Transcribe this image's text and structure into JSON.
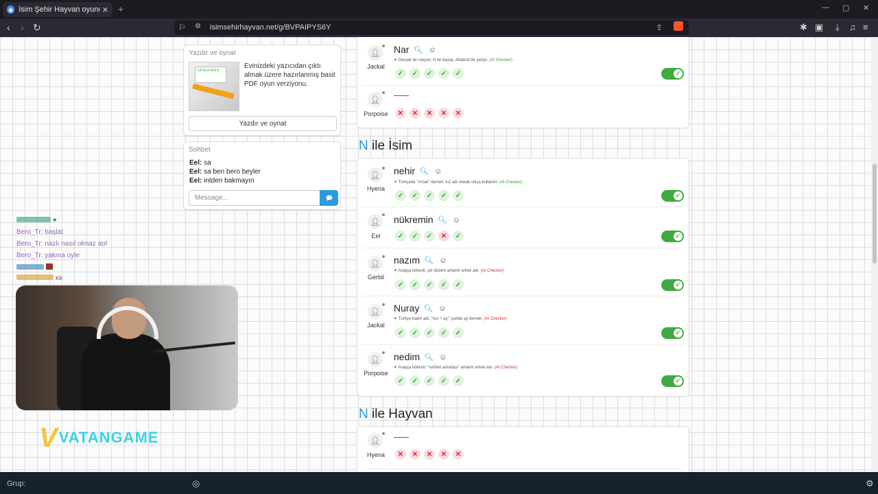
{
  "browser": {
    "tab_title": "İsim Şehir Hayvan oyununa katıl",
    "tab_close": "✕",
    "new_tab": "+",
    "url": "isimsehirhayvan.net/g/BVPAIPYS6Y"
  },
  "print_card": {
    "header": "Yazdır ve oynat",
    "image_text": "CATEGORIES",
    "description": "Evinizdeki yazıcıdan çıktı almak üzere hazırlanmış basit PDF oyun verziyonu.",
    "button": "Yazdır ve oynat"
  },
  "chat": {
    "header": "Sohbet",
    "messages": [
      {
        "user": "Eel:",
        "text": "sa"
      },
      {
        "user": "Eel:",
        "text": "sa ben bero beyler"
      },
      {
        "user": "Eel:",
        "text": "intden bakmayın"
      }
    ],
    "placeholder": "Message..."
  },
  "section_top_rows": [
    {
      "player": "Jackal",
      "answer": "Nar",
      "desc": "Gerçek bir meyve; N ile başlar, Akdeniz'de yetişir.",
      "checker": "(AI Checker)",
      "votes": [
        "ok",
        "ok",
        "ok",
        "ok",
        "ok"
      ],
      "toggle": true
    },
    {
      "player": "Porpoise",
      "answer": "",
      "desc": "",
      "checker": "",
      "votes": [
        "no",
        "no",
        "no",
        "no",
        "no"
      ],
      "toggle": false
    }
  ],
  "section_isim": {
    "letter": "N",
    "title": " ile İsim",
    "rows": [
      {
        "player": "Hyena",
        "answer": "nehir",
        "desc": "Türkçede \"ırmak\" demek; kız adı olarak sıkça kullanılır.",
        "checker": "(AI Checker)",
        "checker_color": "green",
        "votes": [
          "ok",
          "ok",
          "ok",
          "ok",
          "ok"
        ]
      },
      {
        "player": "Eel",
        "answer": "nükremin",
        "desc": "",
        "checker": "",
        "votes": [
          "ok",
          "ok",
          "ok",
          "no",
          "ok"
        ]
      },
      {
        "player": "Gerbil",
        "answer": "nazım",
        "desc": "Arapça kökenli; şiir düzeni anlamlı erkek adı.",
        "checker": "(AI Checker)",
        "checker_color": "red",
        "votes": [
          "ok",
          "ok",
          "ok",
          "ok",
          "ok"
        ]
      },
      {
        "player": "Jackal",
        "answer": "Nuray",
        "desc": "Türkçe kadın adı; \"nur + ay\", parlak ay demek.",
        "checker": "(AI Checker)",
        "checker_color": "red",
        "votes": [
          "ok",
          "ok",
          "ok",
          "ok",
          "ok"
        ]
      },
      {
        "player": "Porpoise",
        "answer": "nedim",
        "desc": "Arapça kökenli; \"sohbet arkadaşı\" anlamlı erkek adı.",
        "checker": "(AI Checker)",
        "checker_color": "red",
        "votes": [
          "ok",
          "ok",
          "ok",
          "ok",
          "ok"
        ]
      }
    ]
  },
  "section_hayvan": {
    "letter": "N",
    "title": " ile Hayvan",
    "rows": [
      {
        "player": "Hyena",
        "votes": [
          "no",
          "no",
          "no",
          "no",
          "no"
        ]
      }
    ]
  },
  "stream_chat": [
    {
      "user": "",
      "text": "",
      "color": "#2e9e6e"
    },
    {
      "user": "Bero_Tr:",
      "text": "başlat",
      "color": "#9b59d0"
    },
    {
      "user": "Bero_Tr:",
      "text": "nazlı nasıl olmaz aol",
      "color": "#9b59d0"
    },
    {
      "user": "Bero_Tr:",
      "text": "yakma oyle",
      "color": "#9b59d0"
    },
    {
      "user": "",
      "text": "",
      "color": "#2f7fc2"
    },
    {
      "user": "",
      "text": "xx",
      "color": "#d59a2b"
    }
  ],
  "logo": {
    "v": "V",
    "text": "VATANGAME"
  },
  "taskbar": {
    "label": "Grup:"
  },
  "colors": {
    "accent": "#2596d6",
    "ok": "#39a339",
    "no": "#d52a3a",
    "toggle": "#3faa3f"
  }
}
